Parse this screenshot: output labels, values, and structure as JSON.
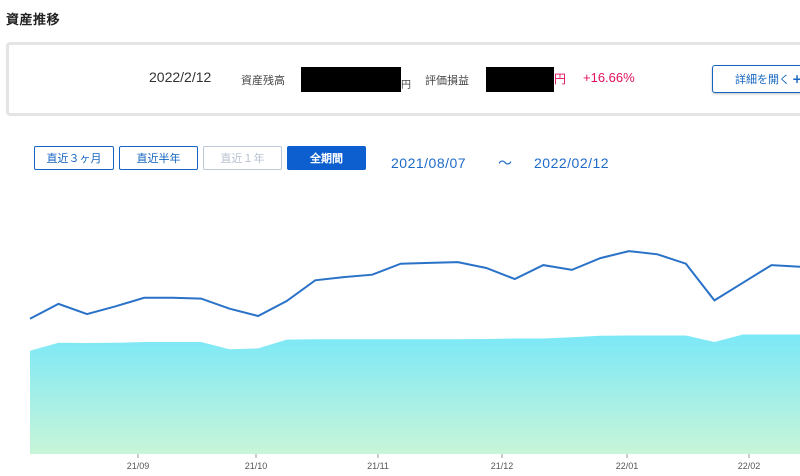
{
  "page": {
    "title": "資産推移"
  },
  "summary": {
    "date": "2022/2/12",
    "balance_label": "資産残高",
    "yen_unit": "円",
    "pl_label": "評価損益",
    "pl_percent": "+16.66%",
    "detail_button_label": "詳細を開く",
    "detail_button_icon": "plus-icon"
  },
  "period_buttons": [
    {
      "label": "直近３ヶ月",
      "state": "normal"
    },
    {
      "label": "直近半年",
      "state": "normal"
    },
    {
      "label": "直近１年",
      "state": "disabled"
    },
    {
      "label": "全期間",
      "state": "active"
    }
  ],
  "range": {
    "start": "2021/08/07",
    "separator": "～",
    "end": "2022/02/12"
  },
  "colors": {
    "line": "#2a72c8",
    "area_top": "#7be8f7",
    "area_bottom": "#c8f5d8",
    "accent": "#0d5fd0",
    "gain": "#e0115f"
  },
  "chart_data": {
    "type": "line",
    "x_ticks": [
      "21/09",
      "21/10",
      "21/11",
      "21/12",
      "22/01",
      "22/02"
    ],
    "y_range": [
      0,
      100
    ],
    "series": [
      {
        "kind": "line",
        "values": [
          50.5,
          56.0,
          52.2,
          55.1,
          58.3,
          58.3,
          58.0,
          54.2,
          51.5,
          57.1,
          64.8,
          66.0,
          66.9,
          71.0,
          71.3,
          71.6,
          69.4,
          65.3,
          70.5,
          68.7,
          73.1,
          75.7,
          74.5,
          71.0,
          57.3,
          63.9,
          70.5,
          69.9
        ]
      },
      {
        "kind": "area",
        "values": [
          38.5,
          41.5,
          41.4,
          41.5,
          41.8,
          41.8,
          41.8,
          39.1,
          39.4,
          42.7,
          42.8,
          42.8,
          42.8,
          42.8,
          42.8,
          42.8,
          42.9,
          43.1,
          43.1,
          43.6,
          44.1,
          44.2,
          44.2,
          44.2,
          41.8,
          44.6,
          44.6,
          44.6
        ]
      }
    ]
  }
}
